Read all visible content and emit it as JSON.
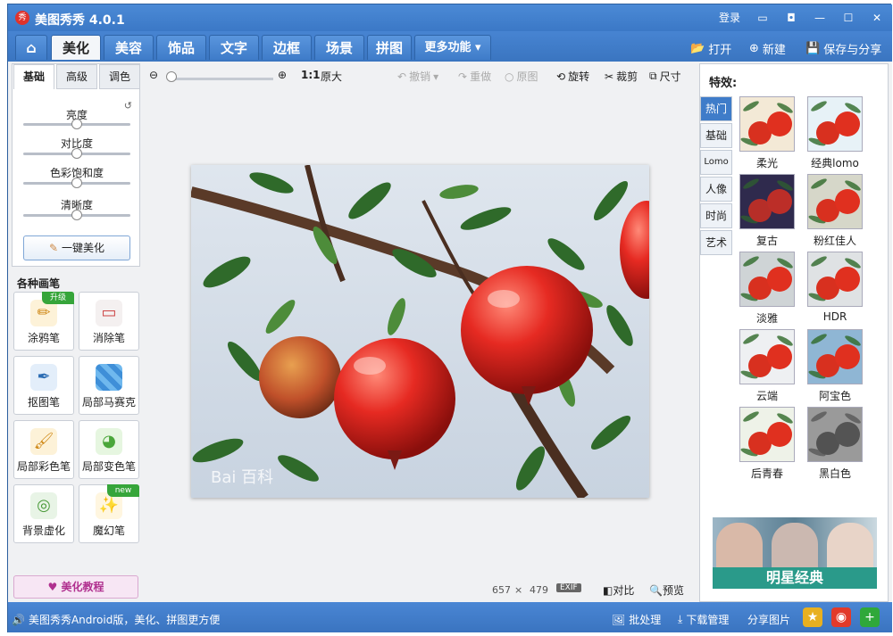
{
  "titlebar": {
    "logo_text": "秀",
    "title": "美图秀秀 4.0.1",
    "login": "登录"
  },
  "tabs": {
    "beautify": "美化",
    "face": "美容",
    "accessory": "饰品",
    "text": "文字",
    "frame": "边框",
    "scene": "场景",
    "collage": "拼图",
    "more": "更多功能"
  },
  "actions": {
    "open": "打开",
    "new": "新建",
    "save_share": "保存与分享"
  },
  "adjust": {
    "subtabs": [
      "基础",
      "高级",
      "调色"
    ],
    "sliders": [
      {
        "label": "亮度",
        "value": 0.5
      },
      {
        "label": "对比度",
        "value": 0.5
      },
      {
        "label": "色彩饱和度",
        "value": 0.5
      },
      {
        "label": "清晰度",
        "value": 0.5
      }
    ],
    "onekey": "一键美化"
  },
  "brushes": {
    "title": "各种画笔",
    "items": [
      {
        "label": "涂鸦笔",
        "badge": "升级"
      },
      {
        "label": "消除笔",
        "badge": ""
      },
      {
        "label": "抠图笔",
        "badge": ""
      },
      {
        "label": "局部马赛克",
        "badge": ""
      },
      {
        "label": "局部彩色笔",
        "badge": ""
      },
      {
        "label": "局部变色笔",
        "badge": ""
      },
      {
        "label": "背景虚化",
        "badge": ""
      },
      {
        "label": "魔幻笔",
        "badge": "new"
      }
    ]
  },
  "tutorial": "美化教程",
  "toolbar": {
    "ratio": "1:1",
    "original_size": "原大",
    "undo": "撤销",
    "redo": "重做",
    "original": "原图",
    "rotate": "旋转",
    "crop": "裁剪",
    "resize": "尺寸"
  },
  "photo": {
    "watermark": "Bai 百科"
  },
  "status": {
    "width": "657",
    "times": "×",
    "height": "479",
    "exif": "EXIF",
    "compare": "对比",
    "preview": "预览"
  },
  "effects": {
    "title": "特效:",
    "categories": [
      "热门",
      "基础",
      "Lomo",
      "人像",
      "时尚",
      "艺术"
    ],
    "items": [
      {
        "label": "柔光",
        "tint": "#f3e9d6"
      },
      {
        "label": "经典lomo",
        "tint": "#e7f2f7"
      },
      {
        "label": "复古",
        "tint": "#2f2a4d"
      },
      {
        "label": "粉红佳人",
        "tint": "#d6d7c9"
      },
      {
        "label": "淡雅",
        "tint": "#cfd4d6"
      },
      {
        "label": "HDR",
        "tint": "#dfe2e4"
      },
      {
        "label": "云端",
        "tint": "#eef0f2"
      },
      {
        "label": "阿宝色",
        "tint": "#8fb6d4"
      },
      {
        "label": "后青春",
        "tint": "#eef2e8"
      },
      {
        "label": "黑白色",
        "tint": "#9a9a9a"
      }
    ],
    "banner_text": "明星经典"
  },
  "bottombar": {
    "promo": "美图秀秀Android版，美化、拼图更方便",
    "batch": "批处理",
    "download": "下载管理",
    "share": "分享图片"
  },
  "colors": {
    "titlebar": "#3b78c6",
    "accent": "#3f7cc9",
    "tutorial": "#b0308f"
  }
}
